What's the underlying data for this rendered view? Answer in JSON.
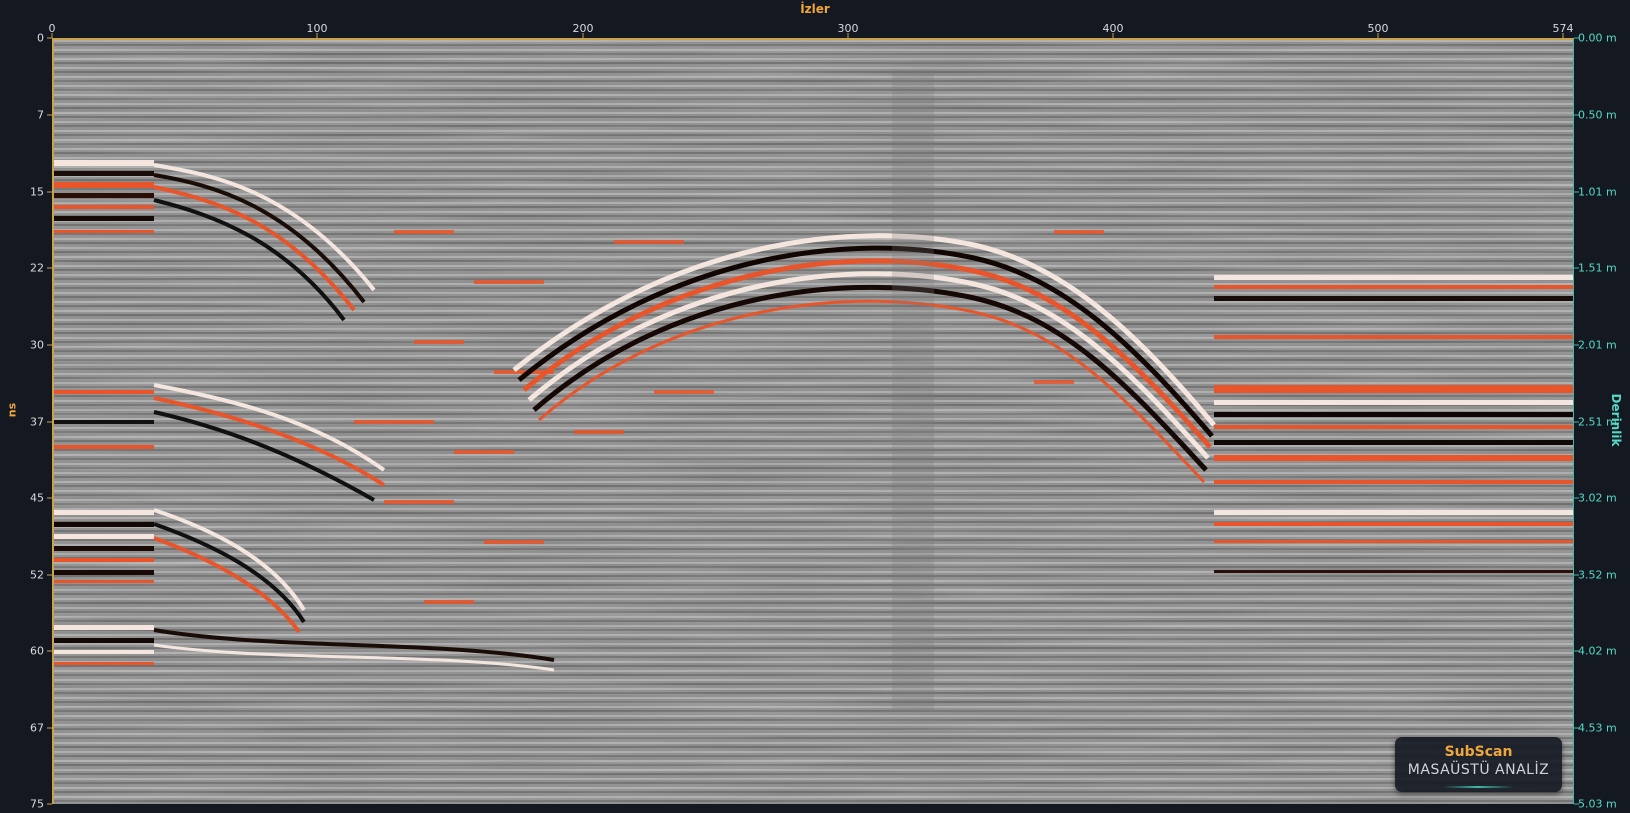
{
  "axes": {
    "top_title": "İzler",
    "left_title": "ns",
    "right_title": "Derinlik",
    "top_ticks": [
      "0",
      "100",
      "200",
      "300",
      "400",
      "500",
      "574"
    ],
    "left_ticks": [
      "0",
      "7",
      "15",
      "22",
      "30",
      "37",
      "45",
      "52",
      "60",
      "67",
      "75"
    ],
    "right_ticks": [
      "0.00 m",
      "0.50 m",
      "1.01 m",
      "1.51 m",
      "2.01 m",
      "2.51 m",
      "3.02 m",
      "3.52 m",
      "4.02 m",
      "4.53 m",
      "5.03 m"
    ]
  },
  "brand": {
    "name": "SubScan",
    "subtitle": "MASAÜSTÜ ANALİZ"
  },
  "colors": {
    "accent_orange": "#f0a63a",
    "depth_teal": "#55d8c6",
    "background": "#131821",
    "reflection_orange": "#e8552a"
  }
}
